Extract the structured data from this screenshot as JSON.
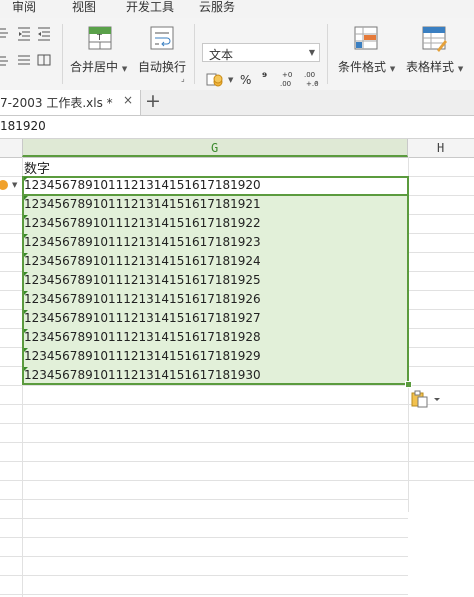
{
  "menu": {
    "items": [
      "审阅",
      "视图",
      "开发工具",
      "云服务"
    ]
  },
  "ribbon": {
    "merge_center_label": "合并居中",
    "auto_wrap_label": "自动换行",
    "number_format_value": "文本",
    "percent_symbol": "%",
    "comma_symbol": "⁹",
    "cond_format_label": "条件格式",
    "table_style_label": "表格样式"
  },
  "tabs": {
    "active_doc": "7-2003 工作表.xls *",
    "close_symbol": "×",
    "new_tab_symbol": "+"
  },
  "formula_bar": {
    "content": "181920"
  },
  "columns": {
    "g": "G",
    "h": "H"
  },
  "sheet": {
    "header_cell": "数字",
    "values": [
      "12345678910111213141516171819 20",
      "123456789101112131415161718192 1",
      "1234567891011121314151617181922",
      "1234567891011121314151617181923",
      "1234567891011121314151617181924",
      "1234567891011121314151617181925",
      "1234567891011121314151617181926",
      "1234567891011121314151617181927",
      "1234567891011121314151617181928",
      "1234567891011121314151617181929",
      "1234567891011121314151617181930"
    ]
  },
  "colors": {
    "selection_border": "#5b9b3e",
    "selection_fill": "#e2f0d9",
    "header_highlight": "#dfe9d5",
    "error_indicator": "#f0a12c"
  }
}
